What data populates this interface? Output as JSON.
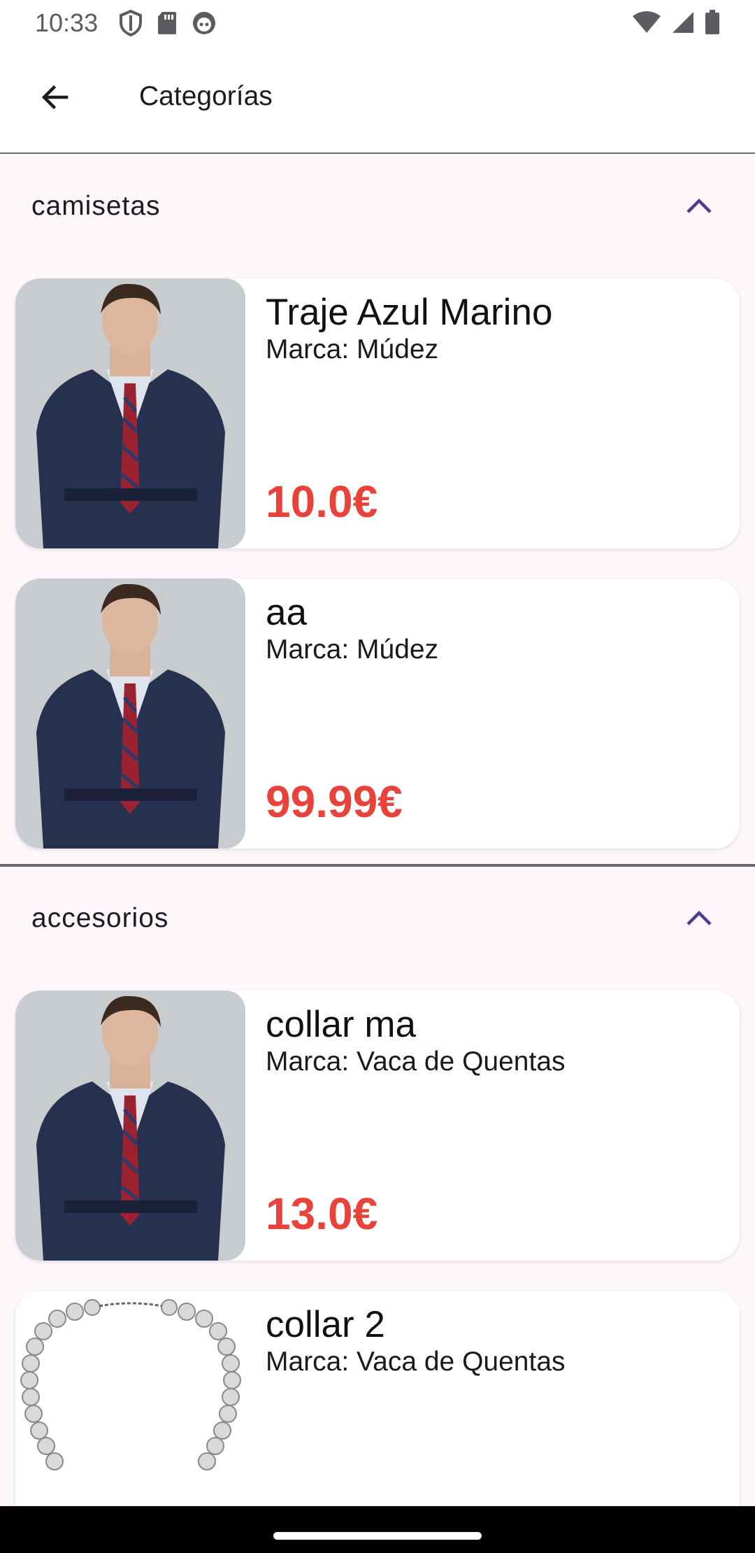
{
  "status_bar": {
    "time": "10:33",
    "left_icons": [
      "shield-icon",
      "sd-card-icon",
      "android-head-icon"
    ],
    "right_icons": [
      "wifi-icon",
      "signal-icon",
      "battery-icon"
    ]
  },
  "app_bar": {
    "back_icon": "arrow-left-icon",
    "title": "Categorías"
  },
  "categories": [
    {
      "name": "camisetas",
      "toggle_icon": "chevron-up-icon",
      "products": [
        {
          "name": "Traje Azul Marino",
          "brand": "Marca: Múdez",
          "price": "10.0€",
          "image": "man-in-suit"
        },
        {
          "name": "aa",
          "brand": "Marca: Múdez",
          "price": "99.99€",
          "image": "man-in-suit"
        }
      ]
    },
    {
      "name": "accesorios",
      "toggle_icon": "chevron-up-icon",
      "products": [
        {
          "name": "collar ma",
          "brand": "Marca: Vaca de Quentas",
          "price": "13.0€",
          "image": "man-in-suit"
        },
        {
          "name": "collar 2",
          "brand": "Marca: Vaca de Quentas",
          "price": "",
          "image": "pearl-necklace"
        }
      ]
    }
  ],
  "colors": {
    "accent": "#4a3f8c",
    "price": "#e8423a",
    "background": "#fdf7fb",
    "divider": "#6b676d"
  }
}
